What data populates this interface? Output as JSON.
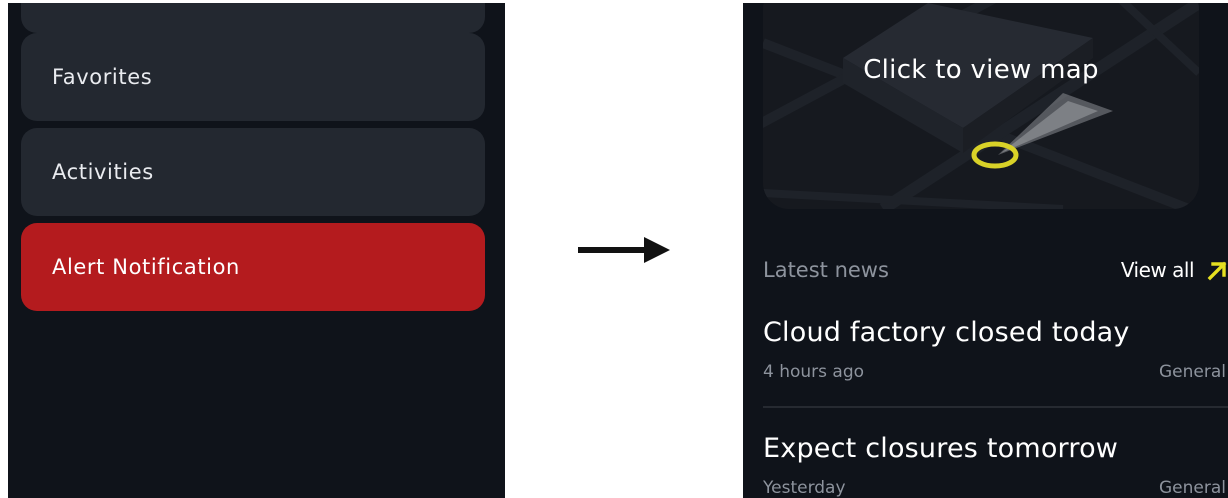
{
  "menu": {
    "items": [
      {
        "label": ""
      },
      {
        "label": "Favorites"
      },
      {
        "label": "Activities"
      },
      {
        "label": "Alert Notification"
      }
    ]
  },
  "map": {
    "title": "Click to view map"
  },
  "news": {
    "section_label": "Latest news",
    "view_all_label": "View all",
    "items": [
      {
        "title": "Cloud factory closed today",
        "time": "4 hours ago",
        "category": "General"
      },
      {
        "title": "Expect closures tomorrow",
        "time": "Yesterday",
        "category": "General"
      }
    ]
  },
  "icons": {
    "transition": "right-arrow-icon",
    "view_all": "arrow-up-right-icon",
    "map_marker": "location-ring-icon"
  },
  "colors": {
    "background": "#0f131a",
    "card": "#232830",
    "alert": "#b41b1e",
    "accent": "#e6e020",
    "muted_text": "#8d939d"
  }
}
